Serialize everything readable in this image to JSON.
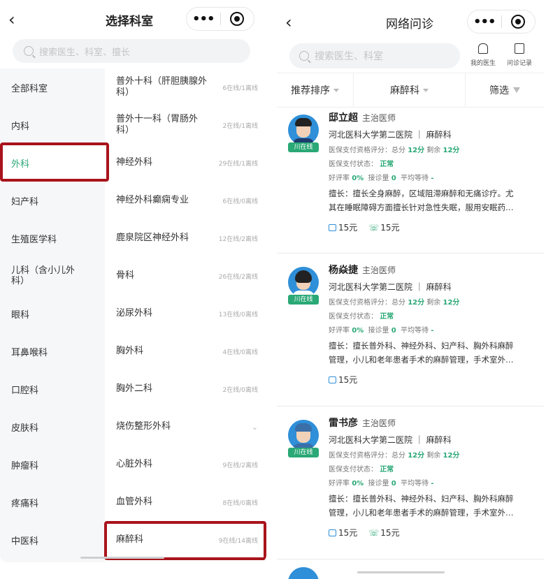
{
  "left": {
    "title": "选择科室",
    "search_placeholder": "搜索医生、科室、擅长",
    "departments": [
      {
        "label": "全部科室"
      },
      {
        "label": "内科"
      },
      {
        "label": "外科",
        "active": true
      },
      {
        "label": "妇产科"
      },
      {
        "label": "生殖医学科"
      },
      {
        "label": "儿科（含小儿外科）"
      },
      {
        "label": "眼科"
      },
      {
        "label": "耳鼻喉科"
      },
      {
        "label": "口腔科"
      },
      {
        "label": "皮肤科"
      },
      {
        "label": "肿瘤科"
      },
      {
        "label": "疼痛科"
      },
      {
        "label": "中医科"
      }
    ],
    "sub_departments": [
      {
        "name": "普外十科（肝胆胰腺外科）",
        "count": "6在线/1离线"
      },
      {
        "name": "普外十一科（胃肠外科）",
        "count": "2在线/1离线"
      },
      {
        "name": "神经外科",
        "count": "29在线/1离线"
      },
      {
        "name": "神经外科癫痫专业",
        "count": "6在线/0离线"
      },
      {
        "name": "鹿泉院区神经外科",
        "count": "12在线/2离线"
      },
      {
        "name": "骨科",
        "count": "26在线/2离线"
      },
      {
        "name": "泌尿外科",
        "count": "13在线/0离线"
      },
      {
        "name": "胸外科",
        "count": "4在线/0离线"
      },
      {
        "name": "胸外二科",
        "count": "2在线/0离线"
      },
      {
        "name": "烧伤整形外科",
        "count": "",
        "expand": "⌄"
      },
      {
        "name": "心脏外科",
        "count": "9在线/2离线"
      },
      {
        "name": "血管外科",
        "count": "8在线/0离线"
      },
      {
        "name": "麻醉科",
        "count": "9在线/14离线"
      }
    ]
  },
  "right": {
    "title": "网络问诊",
    "search_placeholder": "搜索医生、科室",
    "tools": {
      "my_doctor": "我的医生",
      "records": "问诊记录"
    },
    "filters": {
      "sort": "推荐排序",
      "dept": "麻醉科",
      "filter": "筛选"
    },
    "doctors": [
      {
        "name": "邸立超",
        "title": "主治医师",
        "online": "川在线",
        "hospital": "河北医科大学第二医院 ｜ 麻醉科",
        "score_label": "医保支付资格评分：总分",
        "score": "12分",
        "remain_label": "剩余",
        "remain": "12分",
        "status_label": "医保支付状态：",
        "status": "正常",
        "rating_label": "好评率",
        "rating": "0%",
        "accept_label": "接诊量",
        "accept": "0",
        "wait_label": "平均等待",
        "wait": "-",
        "desc1": "擅长：擅长全身麻醉，区域阻滞麻醉和无痛诊疗。尤",
        "desc2": "其在睡眠障碍方面擅长针对急性失眠，服用安眠药…",
        "price_pic": "15元",
        "price_tel": "15元"
      },
      {
        "name": "杨焱捷",
        "title": "主治医师",
        "online": "川在线",
        "hospital": "河北医科大学第二医院 ｜ 麻醉科",
        "score_label": "医保支付资格评分：总分",
        "score": "12分",
        "remain_label": "剩余",
        "remain": "12分",
        "status_label": "医保支付状态：",
        "status": "正常",
        "rating_label": "好评率",
        "rating": "0%",
        "accept_label": "接诊量",
        "accept": "0",
        "wait_label": "平均等待",
        "wait": "-",
        "desc1": "擅长：擅长普外科、神经外科、妇产科、胸外科麻醉",
        "desc2": "管理，小儿和老年患者手术的麻醉管理，手术室外…",
        "price_pic": "15元"
      },
      {
        "name": "雷书彦",
        "title": "主治医师",
        "online": "川在线",
        "hospital": "河北医科大学第二医院 ｜ 麻醉科",
        "score_label": "医保支付资格评分：总分",
        "score": "12分",
        "remain_label": "剩余",
        "remain": "12分",
        "status_label": "医保支付状态：",
        "status": "正常",
        "rating_label": "好评率",
        "rating": "0%",
        "accept_label": "接诊量",
        "accept": "0",
        "wait_label": "平均等待",
        "wait": "-",
        "desc1": "擅长：擅长普外科、神经外科、妇产科、胸外科麻醉",
        "desc2": "管理，小儿和老年患者手术的麻醉管理，手术室外…",
        "price_pic": "15元",
        "price_tel": "15元"
      }
    ]
  },
  "colors": {
    "accent": "#2aa876",
    "highlight": "#a8141b",
    "avatar_bg": "#2f8fd8"
  }
}
